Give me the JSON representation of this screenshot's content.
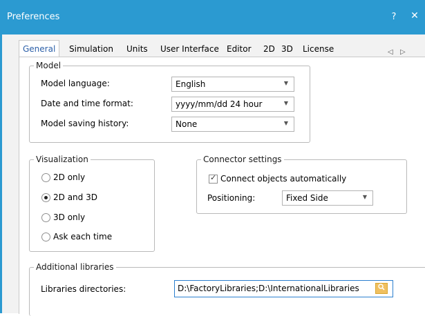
{
  "window": {
    "title": "Preferences",
    "help_label": "?",
    "close_label": "✕",
    "accent_color": "#2b9ad1"
  },
  "tabs": [
    {
      "label": "General",
      "active": true
    },
    {
      "label": "Simulation"
    },
    {
      "label": "Units"
    },
    {
      "label": "User Interface"
    },
    {
      "label": "Editor"
    },
    {
      "label": "2D"
    },
    {
      "label": "3D"
    },
    {
      "label": "License"
    }
  ],
  "tab_scroll": {
    "left": "◁",
    "right": "▷"
  },
  "model": {
    "legend": "Model",
    "language_label": "Model language:",
    "language_value": "English",
    "datetime_label": "Date and time format:",
    "datetime_value": "yyyy/mm/dd  24 hour",
    "history_label": "Model saving history:",
    "history_value": "None",
    "dropdown_icon": "chevron-down-icon"
  },
  "visualization": {
    "legend": "Visualization",
    "options": [
      {
        "label": "2D only",
        "selected": false
      },
      {
        "label": "2D and 3D",
        "selected": true
      },
      {
        "label": "3D only",
        "selected": false
      },
      {
        "label": "Ask each time",
        "selected": false
      }
    ]
  },
  "connector": {
    "legend": "Connector settings",
    "auto_connect_label": "Connect objects automatically",
    "auto_connect_checked": true,
    "positioning_label": "Positioning:",
    "positioning_value": "Fixed Side"
  },
  "libraries": {
    "legend": "Additional libraries",
    "directories_label": "Libraries directories:",
    "directories_value": "D:\\FactoryLibraries;D:\\InternationalLibraries",
    "browse_icon": "folder-search-icon"
  }
}
